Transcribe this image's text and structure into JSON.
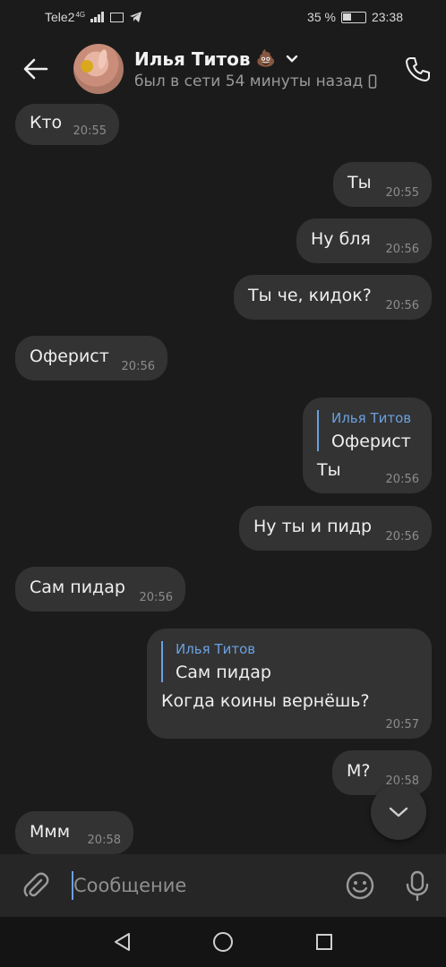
{
  "status_bar": {
    "carrier": "Tele2",
    "network": "4G",
    "battery_percent": "35 %",
    "time": "23:38",
    "icons": [
      "signal-icon",
      "mail-icon",
      "telegram-icon",
      "vibrate-icon",
      "battery-icon"
    ]
  },
  "header": {
    "back_icon": "arrow-left-icon",
    "name": "Илья Титов",
    "name_emoji": "💩",
    "status": "был в сети 54 минуты назад",
    "call_icon": "phone-icon"
  },
  "messages": [
    {
      "text": "Кто",
      "time": "20:55",
      "side": "in"
    },
    {
      "text": "Ты",
      "time": "20:55",
      "side": "out"
    },
    {
      "text": "Ну бля",
      "time": "20:56",
      "side": "out"
    },
    {
      "text": "Ты че, кидок?",
      "time": "20:56",
      "side": "out"
    },
    {
      "text": "Оферист",
      "time": "20:56",
      "side": "in"
    },
    {
      "text": "Ты",
      "time": "20:56",
      "side": "out",
      "reply_author": "Илья Титов",
      "reply_text": "Оферист"
    },
    {
      "text": "Ну ты и пидр",
      "time": "20:56",
      "side": "out"
    },
    {
      "text": "Сам пидар",
      "time": "20:56",
      "side": "in"
    },
    {
      "text": "Когда коины вернёшь?",
      "time": "20:57",
      "side": "out",
      "reply_author": "Илья Титов",
      "reply_text": "Сам пидар"
    },
    {
      "text": "М?",
      "time": "20:58",
      "side": "out"
    },
    {
      "text": "Ммм",
      "time": "20:58",
      "side": "in"
    }
  ],
  "composer": {
    "placeholder": "Сообщение",
    "attach_icon": "paperclip-icon",
    "emoji_icon": "smiley-icon",
    "mic_icon": "microphone-icon"
  },
  "colors": {
    "background": "#1b1b1b",
    "bubble": "#333333",
    "accent": "#6aa0e0"
  }
}
